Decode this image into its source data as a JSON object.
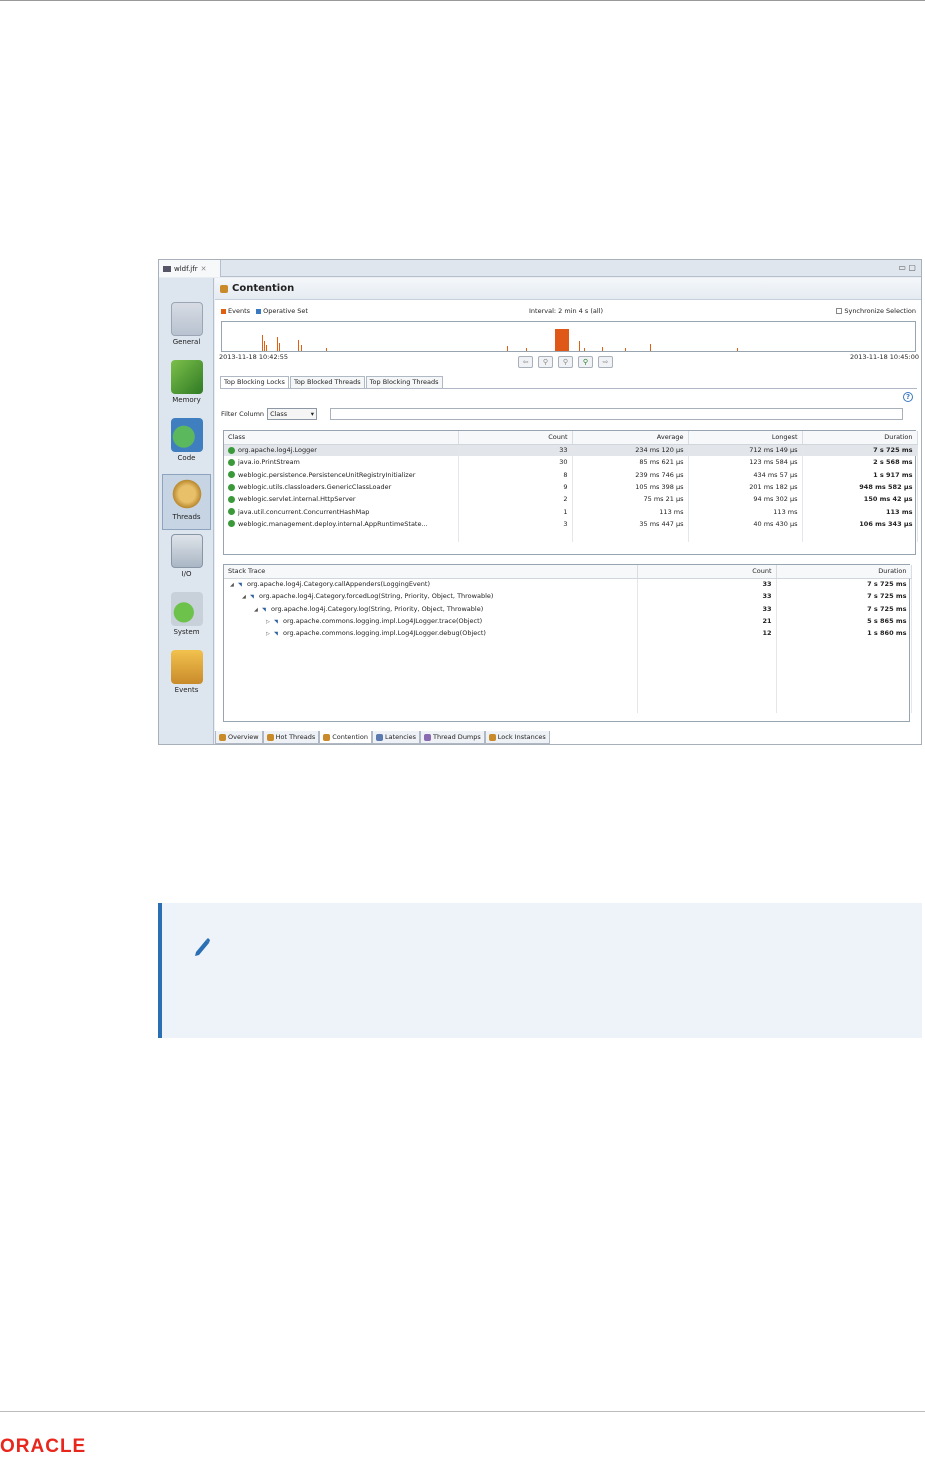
{
  "window": {
    "tab_label": "wldf.jfr",
    "header_title": "Contention",
    "legend": {
      "events": "Events",
      "operative_set": "Operative Set"
    },
    "interval": "Interval: 2 min 4 s (all)",
    "sync_label": "Synchronize Selection",
    "time_start": "2013-11-18 10:42:55",
    "time_end": "2013-11-18 10:45:00",
    "help_glyph": "?",
    "colors": {
      "events": "#e06010",
      "operative": "#3a78c0",
      "accent": "#2a6fb3"
    }
  },
  "sidebar": {
    "items": [
      {
        "label": "General",
        "icon": "general-icon"
      },
      {
        "label": "Memory",
        "icon": "memory-icon"
      },
      {
        "label": "Code",
        "icon": "code-icon"
      },
      {
        "label": "Threads",
        "icon": "threads-icon",
        "selected": true
      },
      {
        "label": "I/O",
        "icon": "io-icon"
      },
      {
        "label": "System",
        "icon": "system-icon"
      },
      {
        "label": "Events",
        "icon": "events-icon"
      }
    ]
  },
  "subtabs": [
    "Top Blocking Locks",
    "Top Blocked Threads",
    "Top Blocking Threads"
  ],
  "filter": {
    "label": "Filter Column",
    "selected": "Class"
  },
  "locks_table": {
    "columns": [
      "Class",
      "Count",
      "Average",
      "Longest",
      "Duration"
    ],
    "rows": [
      [
        "org.apache.log4j.Logger",
        "33",
        "234 ms 120 µs",
        "712 ms 149 µs",
        "7 s 725 ms"
      ],
      [
        "java.io.PrintStream",
        "30",
        "85 ms 621 µs",
        "123 ms 584 µs",
        "2 s 568 ms"
      ],
      [
        "weblogic.persistence.PersistenceUnitRegistryInitializer",
        "8",
        "239 ms 746 µs",
        "434 ms 57 µs",
        "1 s 917 ms"
      ],
      [
        "weblogic.utils.classloaders.GenericClassLoader",
        "9",
        "105 ms 398 µs",
        "201 ms 182 µs",
        "948 ms 582 µs"
      ],
      [
        "weblogic.servlet.internal.HttpServer",
        "2",
        "75 ms 21 µs",
        "94 ms 302 µs",
        "150 ms 42 µs"
      ],
      [
        "java.util.concurrent.ConcurrentHashMap",
        "1",
        "113 ms",
        "113 ms",
        "113 ms"
      ],
      [
        "weblogic.management.deploy.internal.AppRuntimeState...",
        "3",
        "35 ms 447 µs",
        "40 ms 430 µs",
        "106 ms 343 µs"
      ]
    ]
  },
  "stack_table": {
    "columns": [
      "Stack Trace",
      "Count",
      "Duration"
    ],
    "rows": [
      [
        "org.apache.log4j.Category.callAppenders(LoggingEvent)",
        "33",
        "7 s 725 ms"
      ],
      [
        "org.apache.log4j.Category.forcedLog(String, Priority, Object, Throwable)",
        "33",
        "7 s 725 ms"
      ],
      [
        "org.apache.log4j.Category.log(String, Priority, Object, Throwable)",
        "33",
        "7 s 725 ms"
      ],
      [
        "org.apache.commons.logging.impl.Log4JLogger.trace(Object)",
        "21",
        "5 s 865 ms"
      ],
      [
        "org.apache.commons.logging.impl.Log4JLogger.debug(Object)",
        "12",
        "1 s 860 ms"
      ]
    ]
  },
  "bottom_tabs": [
    "Overview",
    "Hot Threads",
    "Contention",
    "Latencies",
    "Thread Dumps",
    "Lock Instances"
  ],
  "footer": {
    "logo": "ORACLE"
  }
}
